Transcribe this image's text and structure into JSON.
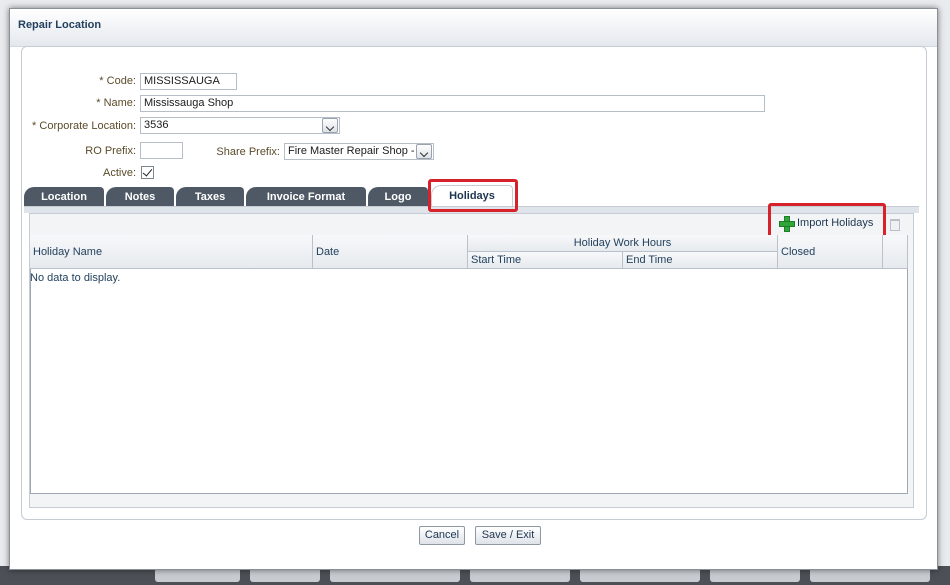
{
  "dialog": {
    "title": "Repair Location"
  },
  "form": {
    "code_label": "* Code:",
    "code_value": "MISSISSAUGA",
    "name_label": "* Name:",
    "name_value": "Mississauga Shop",
    "corporate_label": "* Corporate Location:",
    "corporate_value": "3536",
    "ro_prefix_label": "RO Prefix:",
    "ro_prefix_value": "",
    "share_prefix_label": "Share Prefix:",
    "share_prefix_value": "Fire Master Repair Shop -",
    "active_label": "Active:",
    "active_checked": true
  },
  "tabs": [
    {
      "label": "Location"
    },
    {
      "label": "Notes"
    },
    {
      "label": "Taxes"
    },
    {
      "label": "Invoice Format"
    },
    {
      "label": "Logo"
    },
    {
      "label": "Holidays"
    }
  ],
  "toolbar": {
    "import_label": "Import Holidays"
  },
  "table": {
    "columns": {
      "holiday_name": "Holiday Name",
      "date": "Date",
      "work_hours": "Holiday Work Hours",
      "start_time": "Start Time",
      "end_time": "End Time",
      "closed": "Closed"
    },
    "empty_text": "No data to display."
  },
  "footer": {
    "cancel_label": "Cancel",
    "save_label": "Save / Exit"
  },
  "colors": {
    "highlight": "#d6222a",
    "tab_dark": "#4f5966",
    "title": "#23415e"
  }
}
